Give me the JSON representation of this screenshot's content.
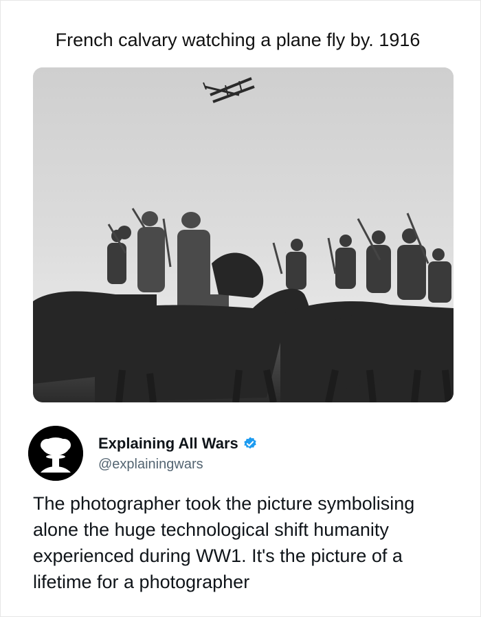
{
  "post": {
    "headline": "French calvary watching a plane fly by. 1916",
    "author": {
      "display_name": "Explaining All Wars",
      "handle": "@explainingwars",
      "verified": true,
      "avatar_icon": "mushroom-cloud-icon"
    },
    "text": "The photographer took the picture symbolising alone the huge technological shift humanity experienced during WW1. It's the picture of a lifetime for a photographer"
  },
  "colors": {
    "verified_badge": "#1d9bf0",
    "handle": "#536471",
    "text": "#0f1419"
  }
}
